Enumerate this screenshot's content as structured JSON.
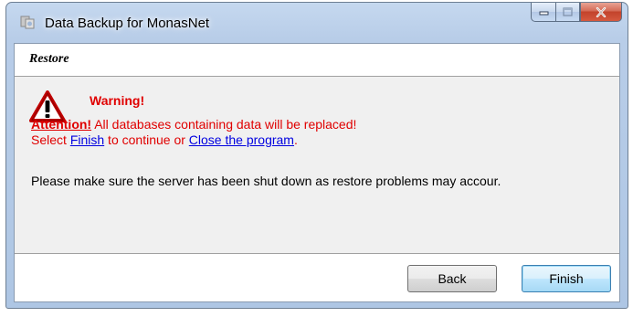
{
  "window": {
    "title": "Data Backup for MonasNet",
    "icon": "app-icon",
    "caption_buttons": {
      "minimize": "minimize-icon",
      "maximize": "maximize-icon",
      "close": "close-icon"
    }
  },
  "header": {
    "title": "Restore"
  },
  "warning": {
    "icon": "warning-icon",
    "title": "Warning!",
    "attention_label": "Attention!",
    "attention_text": " All databases containing data will be replaced!",
    "select_prefix": "Select ",
    "finish_link": "Finish",
    "select_middle": " to continue or ",
    "close_link": "Close the program",
    "select_suffix": ".",
    "info": "Please make sure the server has been shut down as restore problems may accour."
  },
  "footer": {
    "back_label": "Back",
    "finish_label": "Finish"
  },
  "colors": {
    "warning_red": "#e00000",
    "link_blue": "#0000e0",
    "title_bar": "#b8cde8",
    "close_button": "#c2432b"
  }
}
